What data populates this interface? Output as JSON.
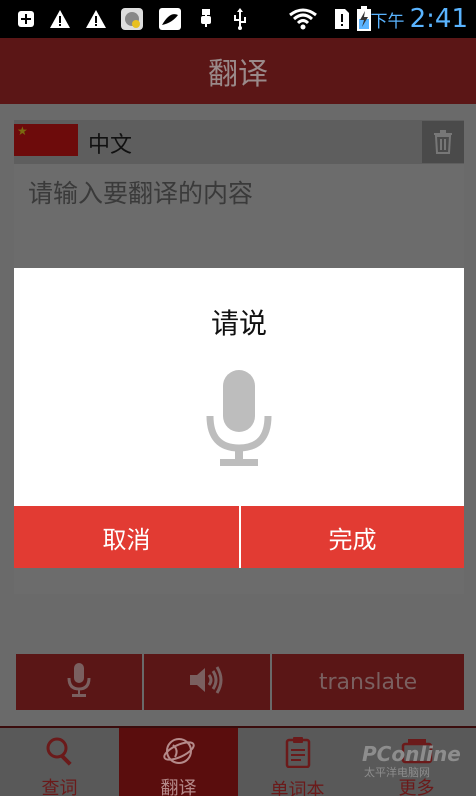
{
  "status_bar": {
    "icons": [
      "add-icon",
      "warning-icon",
      "warning-icon",
      "shield-app-icon",
      "pea-app-icon",
      "usb-icon",
      "usb-debug-icon",
      "wifi-icon",
      "sim-alert-icon",
      "battery-charging-icon"
    ],
    "ampm": "下午",
    "time": "2:41"
  },
  "header": {
    "title": "翻译"
  },
  "main": {
    "source_language": "中文",
    "input_placeholder": "请输入要翻译的内容",
    "actions": {
      "translate_label": "translate"
    }
  },
  "dialog": {
    "title": "请说",
    "cancel_label": "取消",
    "done_label": "完成"
  },
  "tabs": [
    {
      "label": "查词",
      "icon": "search-icon"
    },
    {
      "label": "翻译",
      "icon": "globe-icon",
      "active": true
    },
    {
      "label": "单词本",
      "icon": "clipboard-icon"
    },
    {
      "label": "更多",
      "icon": "more-icon"
    }
  ],
  "watermark": {
    "brand": "PConline",
    "sub": "太平洋电脑网"
  },
  "colors": {
    "accent": "#e23b33",
    "header_bg": "#5b1616",
    "time": "#5ab4ff"
  }
}
